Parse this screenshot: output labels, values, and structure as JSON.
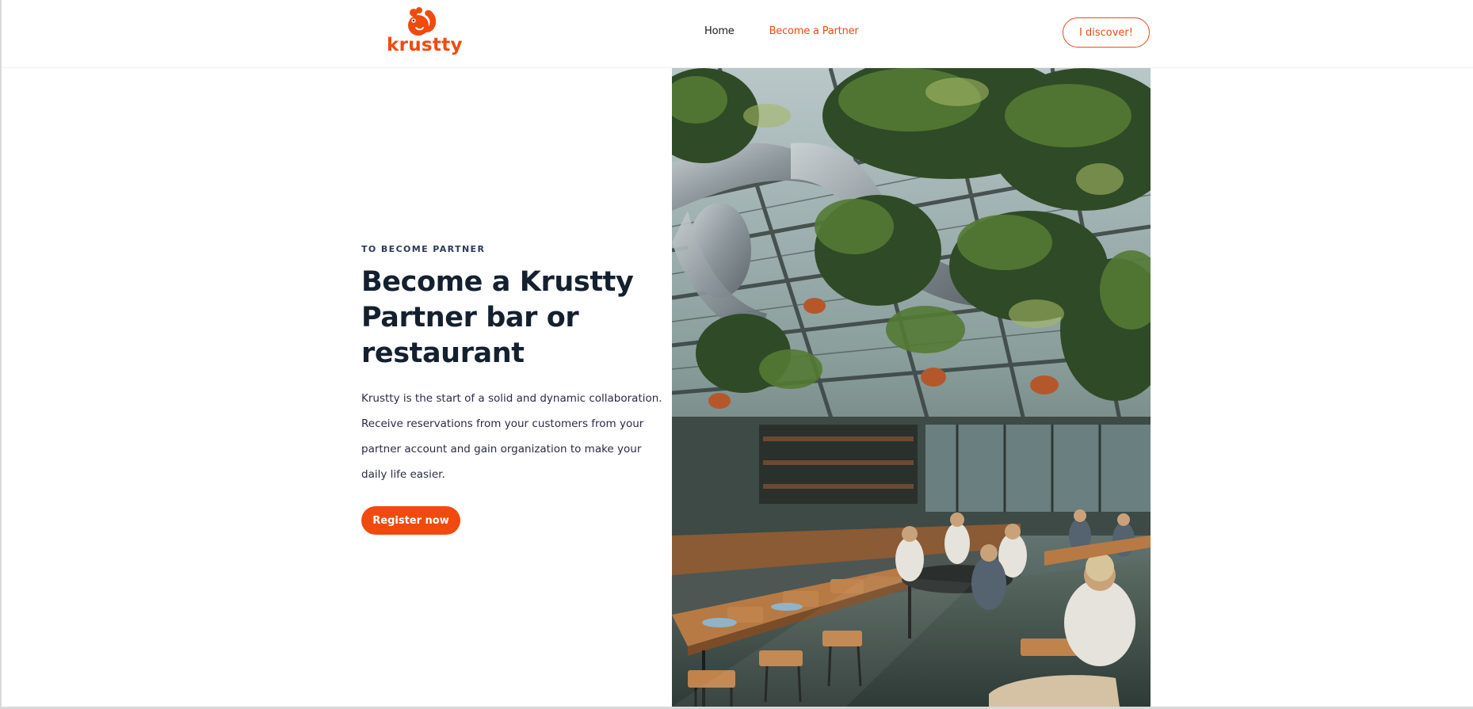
{
  "brand": {
    "name": "krustty",
    "logo_icon": "squirrel-icon",
    "accent_color": "#f04a0f"
  },
  "nav": {
    "items": [
      {
        "label": "Home",
        "active": false
      },
      {
        "label": "Become a Partner",
        "active": true
      }
    ]
  },
  "header": {
    "cta_label": "I discover!"
  },
  "hero": {
    "eyebrow": "TO BECOME PARTNER",
    "title": "Become a Krustty Partner bar or restaurant",
    "description": "Krustty is the start of a solid and dynamic collaboration. Receive reservations from your customers from your partner account and gain organization to make your daily life easier.",
    "button_label": "Register now",
    "image_subject": "greenhouse restaurant interior with hanging plants"
  }
}
